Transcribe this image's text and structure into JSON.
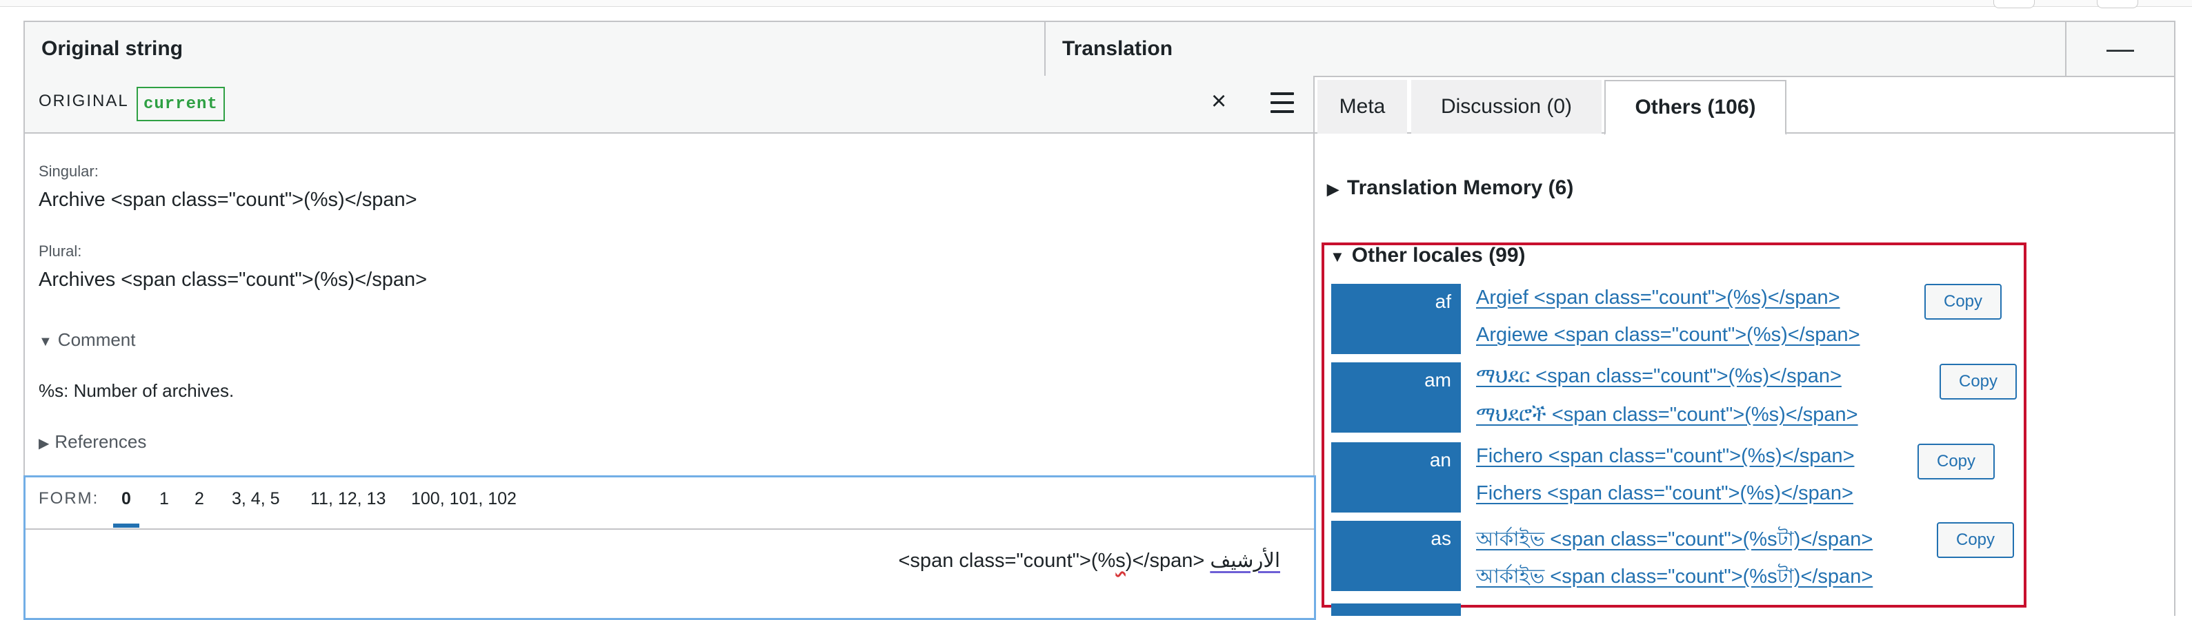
{
  "header": {
    "original_string": "Original string",
    "translation": "Translation",
    "minimize": "—"
  },
  "original": {
    "label": "ORIGINAL",
    "badge": "current",
    "close_icon": "×",
    "singular_label": "Singular:",
    "singular_text": "Archive <span class=\"count\">(%s)</span>",
    "plural_label": "Plural:",
    "plural_text": "Archives <span class=\"count\">(%s)</span>",
    "comment_toggle": "Comment",
    "comment_text": "%s: Number of archives.",
    "references_toggle": "References"
  },
  "form": {
    "label": "FORM:",
    "items": [
      "0",
      "1",
      "2",
      "3, 4, 5",
      "11, 12, 13",
      "100, 101, 102"
    ],
    "active_index": 0,
    "editor_parts": {
      "ltr_part1": "<span class=\"count\">(%",
      "ltr_squiggle": "s",
      "ltr_part2": ")</span> ",
      "arabic_word": "الأرشيف"
    }
  },
  "tabs": [
    {
      "label": "Meta"
    },
    {
      "label": "Discussion (0)"
    },
    {
      "label": "Others (106)",
      "active": true
    }
  ],
  "translation_memory": {
    "label": "Translation Memory (6)",
    "expanded": false
  },
  "other_locales": {
    "label": "Other locales (99)",
    "expanded": true,
    "items": [
      {
        "code": "af",
        "lines": [
          "Argief <span class=\"count\">(%s)</span>",
          "Argiewe <span class=\"count\">(%s)</span>"
        ],
        "copy": "Copy"
      },
      {
        "code": "am",
        "lines": [
          "ማህደር <span class=\"count\">(%s)</span>",
          "ማህደሮች <span class=\"count\">(%s)</span>"
        ],
        "copy": "Copy"
      },
      {
        "code": "an",
        "lines": [
          "Fichero <span class=\"count\">(%s)</span>",
          "Fichers <span class=\"count\">(%s)</span>"
        ],
        "copy": "Copy"
      },
      {
        "code": "as",
        "lines": [
          "আৰ্কাইভ <span class=\"count\">(%sটা)</span>",
          "আৰ্কাইভ <span class=\"count\">(%sটা)</span>"
        ],
        "copy": "Copy"
      }
    ]
  },
  "colors": {
    "accent": "#2271b1",
    "success": "#2ea043",
    "highlight_border": "#c8102e",
    "focus_border": "#72aee6"
  }
}
